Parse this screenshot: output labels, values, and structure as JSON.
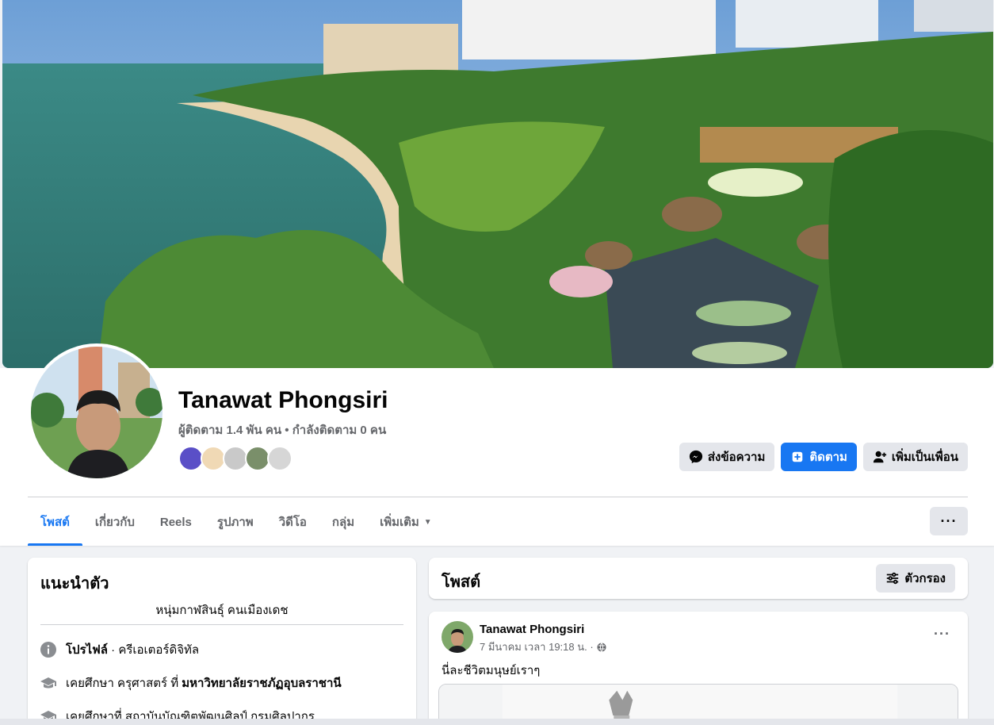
{
  "profile": {
    "name": "Tanawat Phongsiri",
    "followers": "ผู้ติดตาม 1.4 พัน คน • กำลังติดตาม 0 คน",
    "friend_avatar_colors": [
      "#5a4fc7",
      "#f0d9b5",
      "#c9c9c9",
      "#7a8f6a",
      "#d6d6d6"
    ]
  },
  "actions": {
    "message": "ส่งข้อความ",
    "follow": "ติดตาม",
    "add_friend": "เพิ่มเป็นเพื่อน"
  },
  "tabs": [
    {
      "label": "โพสต์",
      "active": true
    },
    {
      "label": "เกี่ยวกับ"
    },
    {
      "label": "Reels"
    },
    {
      "label": "รูปภาพ"
    },
    {
      "label": "วิดีโอ"
    },
    {
      "label": "กลุ่ม"
    },
    {
      "label": "เพิ่มเติม",
      "caret": "▼"
    }
  ],
  "more_menu": "···",
  "intro": {
    "title": "แนะนำตัว",
    "bio": "หนุ่มกาฬสินธุ์ คนเมืองเดช",
    "rows": [
      {
        "icon": "info-icon",
        "bold": "โปรไฟล์",
        "text": " · ครีเอเตอร์ดิจิทัล"
      },
      {
        "icon": "graduation-cap-icon",
        "text": "เคยศึกษา ครุศาสตร์ ที่ ",
        "bold": "มหาวิทยาลัยราชภัฏอุบลราชานี"
      },
      {
        "icon": "graduation-cap-icon",
        "text": "เคยศึกษาที่ สถาบันบัณฑิตพัฒนศิลป์ กรมศิลปากร"
      }
    ]
  },
  "posts": {
    "title": "โพสต์",
    "filter_label": "ตัวกรอง",
    "items": [
      {
        "author": "Tanawat Phongsiri",
        "time": "7 มีนาคม เวลา 19:18 น. ·",
        "privacy_icon": "globe-icon",
        "text": "นี่ละชีวิตมนุษย์เราๆ",
        "menu": "···"
      }
    ]
  },
  "colors": {
    "accent": "#1877f2",
    "secondary_text": "#65676b",
    "button_gray": "#e4e6eb",
    "page_bg": "#f0f2f5"
  }
}
